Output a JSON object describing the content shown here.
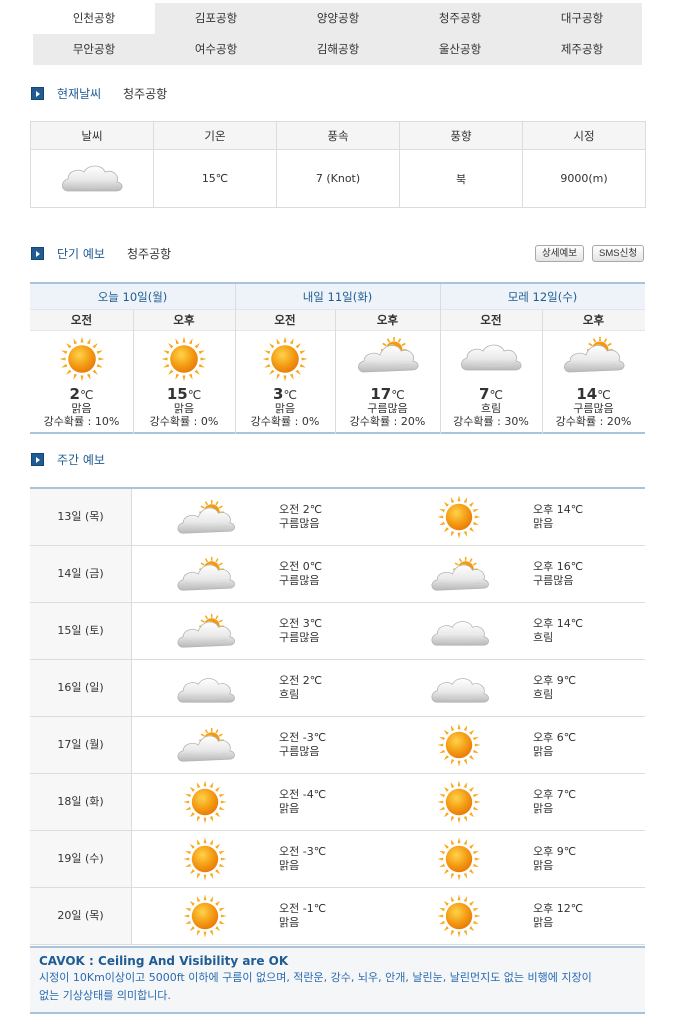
{
  "tabs": [
    {
      "label": "인천공항",
      "active": true
    },
    {
      "label": "김포공항"
    },
    {
      "label": "양양공항"
    },
    {
      "label": "청주공항"
    },
    {
      "label": "대구공항"
    },
    {
      "label": "무안공항"
    },
    {
      "label": "여수공항"
    },
    {
      "label": "김해공항"
    },
    {
      "label": "울산공항"
    },
    {
      "label": "제주공항"
    }
  ],
  "current": {
    "title": "현재날씨",
    "airport": "청주공항",
    "headers": [
      "날씨",
      "기온",
      "풍속",
      "풍향",
      "시정"
    ],
    "weather_icon": "cloudy-icon",
    "temp": "15℃",
    "wind_speed": "7 (Knot)",
    "wind_dir": "북",
    "visibility": "9000(m)"
  },
  "short": {
    "title": "단기 예보",
    "airport": "청주공항",
    "detail_button": "상세예보",
    "sms_button": "SMS신청",
    "days": [
      "오늘 10일(월)",
      "내일 11일(화)",
      "모레 12일(수)"
    ],
    "periods": [
      {
        "label": "오전",
        "icon": "sunny-icon",
        "temp": "2",
        "unit": "℃",
        "cond": "맑음",
        "pop": "강수확률 : 10%"
      },
      {
        "label": "오후",
        "icon": "sunny-icon",
        "temp": "15",
        "unit": "℃",
        "cond": "맑음",
        "pop": "강수확률 : 0%"
      },
      {
        "label": "오전",
        "icon": "sunny-icon",
        "temp": "3",
        "unit": "℃",
        "cond": "맑음",
        "pop": "강수확률 : 0%"
      },
      {
        "label": "오후",
        "icon": "partly-cloudy-icon",
        "temp": "17",
        "unit": "℃",
        "cond": "구름많음",
        "pop": "강수확률 : 20%"
      },
      {
        "label": "오전",
        "icon": "cloudy-icon",
        "temp": "7",
        "unit": "℃",
        "cond": "흐림",
        "pop": "강수확률 : 30%"
      },
      {
        "label": "오후",
        "icon": "partly-cloudy-icon",
        "temp": "14",
        "unit": "℃",
        "cond": "구름많음",
        "pop": "강수확률 : 20%"
      }
    ]
  },
  "weekly": {
    "title": "주간 예보",
    "rows": [
      {
        "date": "13일 (목)",
        "am_icon": "partly-cloudy-icon",
        "am_temp": "오전 2℃",
        "am_cond": "구름많음",
        "pm_icon": "sunny-icon",
        "pm_temp": "오후 14℃",
        "pm_cond": "맑음"
      },
      {
        "date": "14일 (금)",
        "am_icon": "partly-cloudy-icon",
        "am_temp": "오전 0℃",
        "am_cond": "구름많음",
        "pm_icon": "partly-cloudy-icon",
        "pm_temp": "오후 16℃",
        "pm_cond": "구름많음"
      },
      {
        "date": "15일 (토)",
        "am_icon": "partly-cloudy-icon",
        "am_temp": "오전 3℃",
        "am_cond": "구름많음",
        "pm_icon": "cloudy-icon",
        "pm_temp": "오후 14℃",
        "pm_cond": "흐림"
      },
      {
        "date": "16일 (일)",
        "am_icon": "cloudy-icon",
        "am_temp": "오전 2℃",
        "am_cond": "흐림",
        "pm_icon": "cloudy-icon",
        "pm_temp": "오후 9℃",
        "pm_cond": "흐림"
      },
      {
        "date": "17일 (월)",
        "am_icon": "partly-cloudy-icon",
        "am_temp": "오전 -3℃",
        "am_cond": "구름많음",
        "pm_icon": "sunny-icon",
        "pm_temp": "오후 6℃",
        "pm_cond": "맑음"
      },
      {
        "date": "18일 (화)",
        "am_icon": "sunny-icon",
        "am_temp": "오전 -4℃",
        "am_cond": "맑음",
        "pm_icon": "sunny-icon",
        "pm_temp": "오후 7℃",
        "pm_cond": "맑음"
      },
      {
        "date": "19일 (수)",
        "am_icon": "sunny-icon",
        "am_temp": "오전 -3℃",
        "am_cond": "맑음",
        "pm_icon": "sunny-icon",
        "pm_temp": "오후 9℃",
        "pm_cond": "맑음"
      },
      {
        "date": "20일 (목)",
        "am_icon": "sunny-icon",
        "am_temp": "오전 -1℃",
        "am_cond": "맑음",
        "pm_icon": "sunny-icon",
        "pm_temp": "오후 12℃",
        "pm_cond": "맑음"
      }
    ]
  },
  "note": {
    "title": "CAVOK : Ceiling And Visibility are OK",
    "body": "시정이 10Km이상이고 5000ft 이하에 구름이 없으며, 적란운, 강수, 뇌우, 안개, 날린눈, 날린먼지도 없는 비행에 지장이 없는 기상상태를 의미합니다."
  },
  "colors": {
    "accent": "#1f5c94",
    "border_accent": "#a7c4dc",
    "sun": "#f39a12",
    "note_text": "#2a6bb0"
  }
}
